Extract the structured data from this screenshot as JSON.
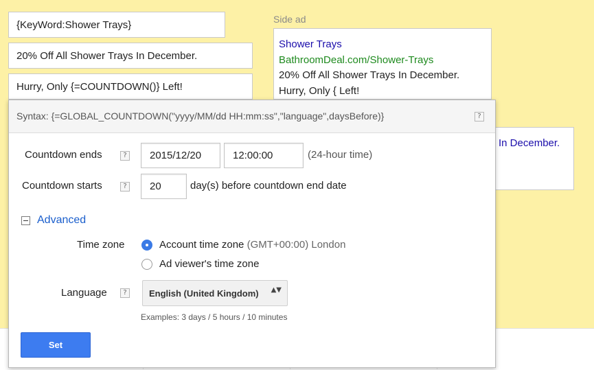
{
  "ad_fields": {
    "headline": "{KeyWord:Shower Trays}",
    "description_line1": "20% Off All Shower Trays In December.",
    "description_line2": "Hurry, Only {=COUNTDOWN()} Left!"
  },
  "side_ad": {
    "label": "Side ad",
    "title": "Shower Trays",
    "display_url": "BathroomDeal.com/Shower-Trays",
    "line1": "20% Off All Shower Trays In December.",
    "line2": "Hurry, Only { Left!"
  },
  "background_ad": {
    "partial_text": "In December."
  },
  "popup": {
    "syntax": "Syntax: {=GLOBAL_COUNTDOWN(\"yyyy/MM/dd HH:mm:ss\",\"language\",daysBefore)}",
    "help_glyph": "?",
    "countdown_ends_label": "Countdown ends",
    "end_date_value": "2015/12/20",
    "end_time_value": "12:00:00",
    "time_format_hint": "(24-hour time)",
    "countdown_starts_label": "Countdown starts",
    "days_before_value": "20",
    "days_hint": "day(s) before countdown end date",
    "advanced_label": "Advanced",
    "time_zone_label": "Time zone",
    "tz_account_label": "Account time zone",
    "tz_account_detail": "(GMT+00:00) London",
    "tz_viewer_label": "Ad viewer's time zone",
    "language_label": "Language",
    "language_value": "English (United Kingdom)",
    "select_arrows": "▲▼",
    "examples": "Examples: 3 days / 5 hours / 10 minutes",
    "set_label": "Set"
  },
  "colors": {
    "background": "#fdf1a6",
    "ad_title": "#1a0dab",
    "ad_url": "#1e8a1e",
    "link": "#1a5ecc",
    "primary_button": "#3d7cf0"
  }
}
